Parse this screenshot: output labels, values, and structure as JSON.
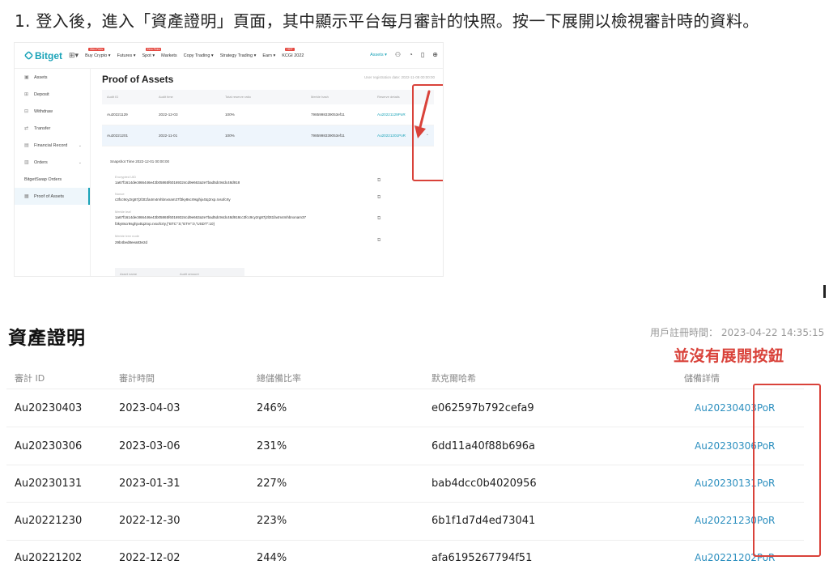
{
  "instruction": "1. 登入後，進入「資產證明」頁面，其中顯示平台每月審計的快照。按一下展開以檢視審計時的資料。",
  "screenshot": {
    "logo": "Bitget",
    "nav": [
      {
        "label": "Buy Crypto ▾",
        "badge": "Zero Fees"
      },
      {
        "label": "Futures ▾",
        "badge": ""
      },
      {
        "label": "Spot ▾",
        "badge": "Zero Fees"
      },
      {
        "label": "Markets",
        "badge": ""
      },
      {
        "label": "Copy Trading ▾",
        "badge": ""
      },
      {
        "label": "Strategy Trading ▾",
        "badge": ""
      },
      {
        "label": "Earn ▾",
        "badge": ""
      },
      {
        "label": "KCGI 2022",
        "badge": "HOT"
      }
    ],
    "nav_assets": "Assets ▾",
    "sidebar": [
      {
        "label": "Assets",
        "icon": "wallet-icon",
        "glyph": "▣",
        "caret": ""
      },
      {
        "label": "Deposit",
        "icon": "deposit-icon",
        "glyph": "⊞",
        "caret": ""
      },
      {
        "label": "Withdraw",
        "icon": "withdraw-icon",
        "glyph": "⊟",
        "caret": ""
      },
      {
        "label": "Transfer",
        "icon": "transfer-icon",
        "glyph": "⇄",
        "caret": ""
      },
      {
        "label": "Financial Record",
        "icon": "record-icon",
        "glyph": "▤",
        "caret": "⌄"
      },
      {
        "label": "Orders",
        "icon": "orders-icon",
        "glyph": "▥",
        "caret": "⌄"
      },
      {
        "label": "BitgetSwap Orders",
        "icon": "",
        "glyph": "",
        "caret": ""
      },
      {
        "label": "Proof of Assets",
        "icon": "proof-icon",
        "glyph": "▦",
        "caret": ""
      }
    ],
    "title": "Proof of Assets",
    "registration": "User registration date: 2022-11-08 00:00:00",
    "columns": [
      "Audit ID",
      "Audit time",
      "Total reserve ratio",
      "Merkle hash",
      "Reserve details"
    ],
    "rows": [
      {
        "id": "Au20221129",
        "time": "2022-12-03",
        "ratio": "100%",
        "hash": "7985998339053ef11",
        "detail": "Au20221129PoR"
      },
      {
        "id": "Au20221201",
        "time": "2022-11-01",
        "ratio": "100%",
        "hash": "7985998339053ef11",
        "detail": "Au20221201PoR"
      }
    ],
    "expanded": {
      "snapshot": "Snapshot Time 2022-12-01 00:00:00",
      "fields": [
        {
          "label": "Encrypted UID",
          "value": "1a67f1614dec866446e43b05865f60169324cd9e663a2e7bad5dc94dc48d918"
        },
        {
          "label": "Nonce",
          "value": "c3fcc9cy2rg87j2l3t1fa4m4mhbnxnam37f3ky8scr9sghjx4tq2rxp.rxsofcrty"
        },
        {
          "label": "Merkle leaf",
          "value": "1a67f1614dec866446e43b05865f60169324cd9e663a2e7bad5dc94dc48d918cc3fcc9cy2rg87j2l3t1fa4m4mhbnxnam37"
        },
        {
          "label": "Merkle tree node",
          "value": "29b4bed8eea83e2d"
        }
      ],
      "leaf_line2": "f3ky8scr9sghjx4tq2rxp.rxsofcrty,{\"BTC\":0,\"ETH\":0,\"USDT\":10}",
      "table_headers": [
        "Asset name",
        "Audit amount"
      ]
    }
  },
  "page": {
    "title": "資產證明",
    "registration": "用戶註冊時間： 2023-04-22 14:35:15",
    "annotation": "並沒有展開按鈕",
    "columns": [
      "審計 ID",
      "審計時間",
      "總儲備比率",
      "默克爾哈希",
      "儲備詳情"
    ],
    "rows": [
      {
        "id": "Au20230403",
        "time": "2023-04-03",
        "ratio": "246%",
        "hash": "e062597b792cefa9",
        "detail": "Au20230403PoR"
      },
      {
        "id": "Au20230306",
        "time": "2023-03-06",
        "ratio": "231%",
        "hash": "6dd11a40f88b696a",
        "detail": "Au20230306PoR"
      },
      {
        "id": "Au20230131",
        "time": "2023-01-31",
        "ratio": "227%",
        "hash": "bab4dcc0b4020956",
        "detail": "Au20230131PoR"
      },
      {
        "id": "Au20221230",
        "time": "2022-12-30",
        "ratio": "223%",
        "hash": "6b1f1d7d4ed73041",
        "detail": "Au20221230PoR"
      },
      {
        "id": "Au20221202",
        "time": "2022-12-02",
        "ratio": "244%",
        "hash": "afa6195267794f51",
        "detail": "Au20221202PoR"
      }
    ]
  },
  "colors": {
    "annotation_red": "#d9423a",
    "brand": "#1aa3b8",
    "link": "#2c8fbf"
  }
}
